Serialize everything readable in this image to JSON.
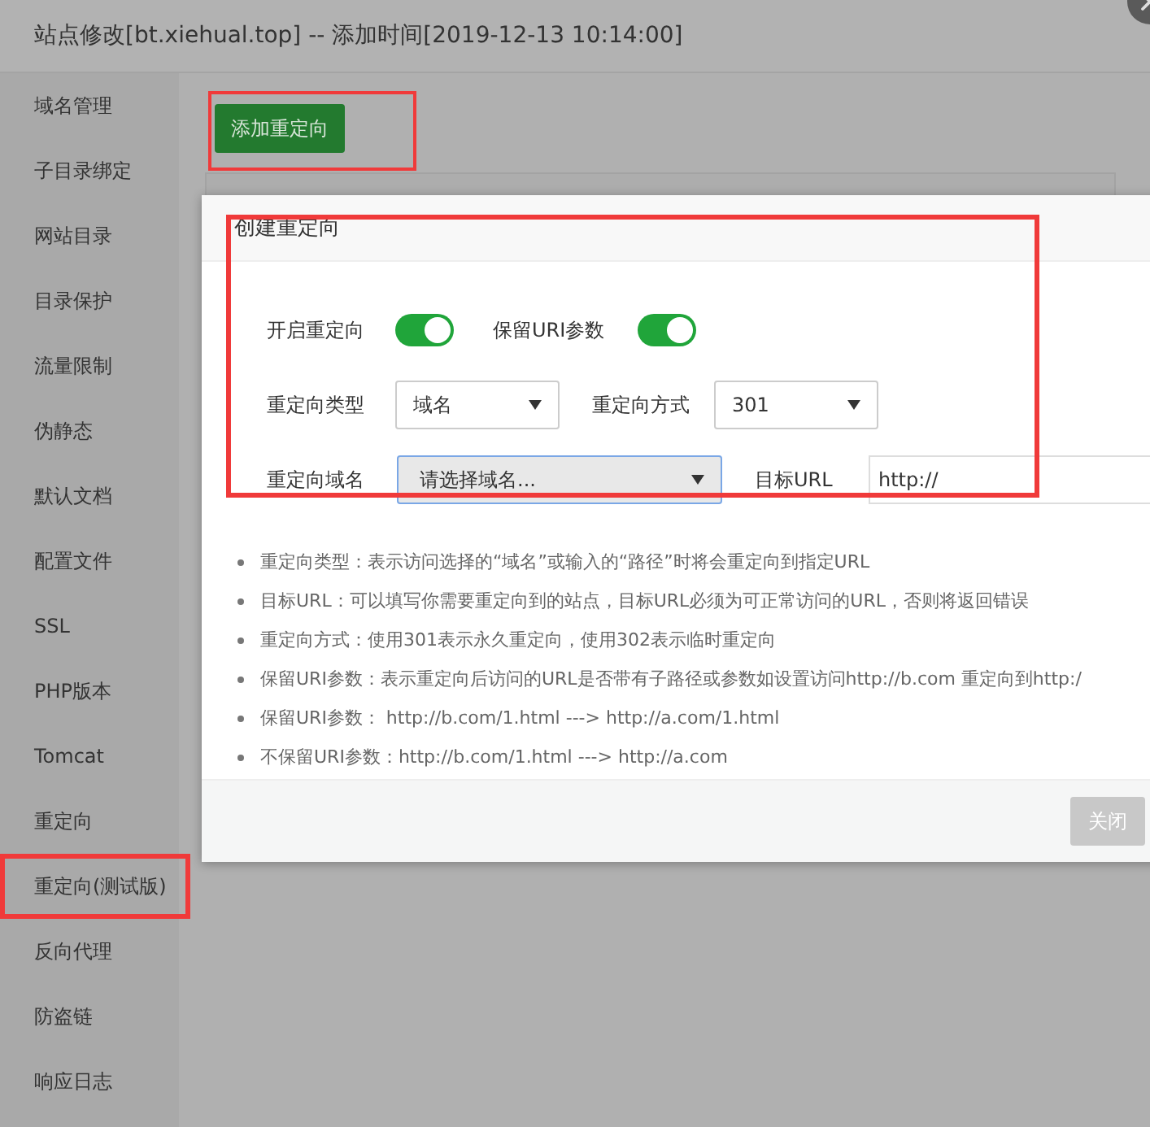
{
  "window": {
    "title": "站点修改[bt.xiehual.top] -- 添加时间[2019-12-13 10:14:00]"
  },
  "sidebar": {
    "items": [
      {
        "label": "域名管理",
        "annotated": false
      },
      {
        "label": "子目录绑定",
        "annotated": false
      },
      {
        "label": "网站目录",
        "annotated": false
      },
      {
        "label": "目录保护",
        "annotated": false
      },
      {
        "label": "流量限制",
        "annotated": false
      },
      {
        "label": "伪静态",
        "annotated": false
      },
      {
        "label": "默认文档",
        "annotated": false
      },
      {
        "label": "配置文件",
        "annotated": false
      },
      {
        "label": "SSL",
        "annotated": false
      },
      {
        "label": "PHP版本",
        "annotated": false
      },
      {
        "label": "Tomcat",
        "annotated": false
      },
      {
        "label": "重定向",
        "annotated": false
      },
      {
        "label": "重定向(测试版)",
        "annotated": true
      },
      {
        "label": "反向代理",
        "annotated": false
      },
      {
        "label": "防盗链",
        "annotated": false
      },
      {
        "label": "响应日志",
        "annotated": false
      }
    ]
  },
  "add_button": {
    "label": "添加重定向",
    "annotated": true
  },
  "dialog": {
    "title": "创建重定向",
    "annotated": true,
    "toggles": [
      {
        "label": "开启重定向",
        "on": true
      },
      {
        "label": "保留URI参数",
        "on": true
      }
    ],
    "selects": [
      {
        "label": "重定向类型",
        "value": "域名",
        "focused": false
      },
      {
        "label": "重定向方式",
        "value": "301",
        "focused": false
      }
    ],
    "domain_select": {
      "label": "重定向域名",
      "value": "请选择域名...",
      "focused": true
    },
    "target": {
      "label": "目标URL",
      "value": "http://"
    },
    "notes": [
      "重定向类型：表示访问选择的“域名”或输入的“路径”时将会重定向到指定URL",
      "目标URL：可以填写你需要重定向到的站点，目标URL必须为可正常访问的URL，否则将返回错误",
      "重定向方式：使用301表示永久重定向，使用302表示临时重定向",
      "保留URI参数：表示重定向后访问的URL是否带有子路径或参数如设置访问http://b.com 重定向到http:/",
      "保留URI参数： http://b.com/1.html ---> http://a.com/1.html",
      "不保留URI参数：http://b.com/1.html ---> http://a.com"
    ],
    "close_button": {
      "label": "关闭",
      "disabled": true
    }
  }
}
